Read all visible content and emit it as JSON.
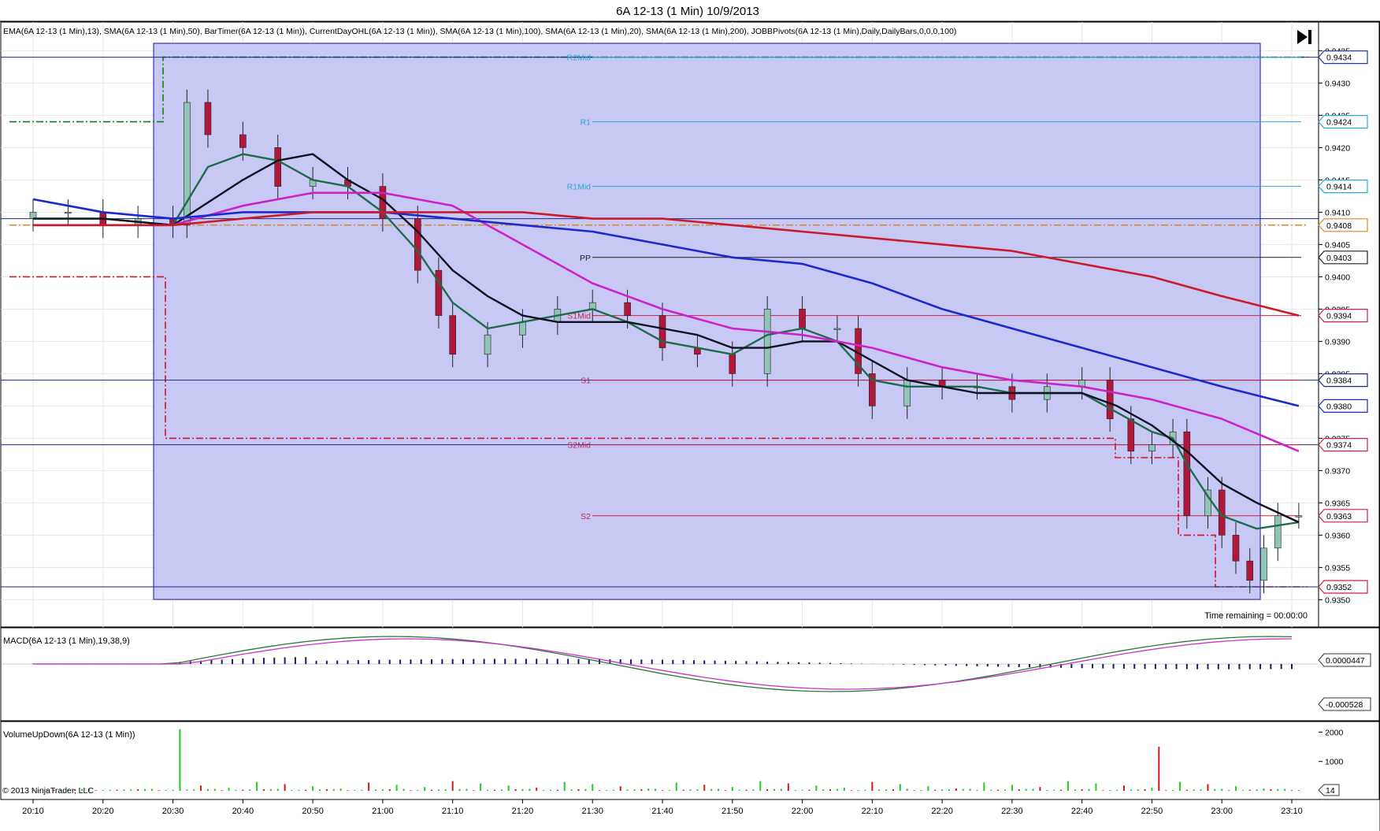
{
  "window": {
    "title": "6A 12-13 (1 Min)  10/9/2013"
  },
  "toolbar": {
    "jump_to_end_icon": "skip-to-end-icon"
  },
  "price_panel": {
    "indicator_list": "EMA(6A 12-13 (1 Min),13), SMA(6A 12-13 (1 Min),50), BarTimer(6A 12-13 (1 Min)), CurrentDayOHL(6A 12-13 (1 Min)), SMA(6A 12-13 (1 Min),100), SMA(6A 12-13 (1 Min),20), SMA(6A 12-13 (1 Min),200), JOBBPivots(6A 12-13 (1 Min),Daily,DailyBars,0,0,0,100)",
    "time_remaining": "Time remaining = 00:00:00",
    "y_ticks": [
      "0.9435",
      "0.9430",
      "0.9425",
      "0.9420",
      "0.9415",
      "0.9410",
      "0.9405",
      "0.9400",
      "0.9395",
      "0.9390",
      "0.9385",
      "0.9380",
      "0.9375",
      "0.9370",
      "0.9365",
      "0.9360",
      "0.9355",
      "0.9350"
    ],
    "price_markers": [
      {
        "label": "0.9434",
        "color": "#2a3a9a"
      },
      {
        "label": "0.9424",
        "color": "#2aa8d8"
      },
      {
        "label": "0.9414",
        "color": "#2aa8d8"
      },
      {
        "label": "0.9408",
        "color": "#d88a20"
      },
      {
        "label": "0.9403",
        "color": "#222222"
      },
      {
        "label": "0.9394",
        "color": "#cc2244"
      },
      {
        "label": "0.9384",
        "color": "#1a2a8a"
      },
      {
        "label": "0.9380",
        "color": "#1a2acc"
      },
      {
        "label": "0.9374",
        "color": "#cc2244"
      },
      {
        "label": "0.9363",
        "color": "#cc2244"
      },
      {
        "label": "0.9352",
        "color": "#cc2244"
      }
    ],
    "pivot_labels": [
      "R2Mid",
      "R1",
      "R1Mid",
      "PP",
      "S1Mid",
      "S1",
      "S2Mid",
      "S2"
    ]
  },
  "macd_panel": {
    "label": "MACD(6A 12-13 (1 Min),19,38,9)",
    "markers": [
      "0.0000447",
      "-0.000528"
    ]
  },
  "volume_panel": {
    "label": "VolumeUpDown(6A 12-13 (1 Min))",
    "y_ticks": [
      "2000",
      "1000"
    ],
    "marker": "14",
    "copyright": "© 2013 NinjaTrader, LLC"
  },
  "x_axis": {
    "ticks": [
      "20:10",
      "20:20",
      "20:30",
      "20:40",
      "20:50",
      "21:00",
      "21:10",
      "21:20",
      "21:30",
      "21:40",
      "21:50",
      "22:00",
      "22:10",
      "22:20",
      "22:30",
      "22:40",
      "22:50",
      "23:00",
      "23:10"
    ]
  },
  "chart_data": {
    "type": "line",
    "title": "6A 12-13 (1 Min)  10/9/2013",
    "xlabel": "",
    "ylabel": "",
    "ylim": [
      0.9347,
      0.9437
    ],
    "grid": true,
    "candles_approx": {
      "time": [
        "20:10",
        "20:15",
        "20:20",
        "20:25",
        "20:30",
        "20:32",
        "20:35",
        "20:40",
        "20:45",
        "20:50",
        "20:55",
        "21:00",
        "21:05",
        "21:08",
        "21:10",
        "21:15",
        "21:20",
        "21:25",
        "21:30",
        "21:35",
        "21:40",
        "21:45",
        "21:50",
        "21:55",
        "22:00",
        "22:05",
        "22:08",
        "22:10",
        "22:15",
        "22:20",
        "22:25",
        "22:30",
        "22:35",
        "22:40",
        "22:44",
        "22:47",
        "22:50",
        "22:53",
        "22:55",
        "22:58",
        "23:00",
        "23:02",
        "23:04",
        "23:06",
        "23:08",
        "23:11"
      ],
      "close": [
        0.941,
        0.941,
        0.9408,
        0.9409,
        0.9408,
        0.9427,
        0.9422,
        0.942,
        0.9414,
        0.9415,
        0.9414,
        0.9409,
        0.9401,
        0.9394,
        0.9388,
        0.9391,
        0.9393,
        0.9395,
        0.9396,
        0.9394,
        0.9389,
        0.9388,
        0.9385,
        0.9395,
        0.9392,
        0.9392,
        0.9385,
        0.938,
        0.9384,
        0.9383,
        0.9383,
        0.9381,
        0.9383,
        0.9384,
        0.9378,
        0.9373,
        0.9374,
        0.9376,
        0.9363,
        0.9367,
        0.936,
        0.9356,
        0.9353,
        0.9358,
        0.9363,
        0.9363
      ]
    },
    "series": [
      {
        "name": "EMA(6A 12-13 (1 Min),13)",
        "color": "#1f6b4a",
        "x": [
          "20:10",
          "20:20",
          "20:30",
          "20:35",
          "20:40",
          "20:45",
          "20:50",
          "20:55",
          "21:00",
          "21:05",
          "21:10",
          "21:15",
          "21:20",
          "21:25",
          "21:30",
          "21:35",
          "21:40",
          "21:45",
          "21:50",
          "21:55",
          "22:00",
          "22:05",
          "22:10",
          "22:15",
          "22:20",
          "22:25",
          "22:30",
          "22:35",
          "22:40",
          "22:45",
          "22:50",
          "22:53",
          "22:55",
          "22:58",
          "23:00",
          "23:05",
          "23:11"
        ],
        "y": [
          0.9409,
          0.9409,
          0.9408,
          0.9417,
          0.9419,
          0.9418,
          0.9415,
          0.9414,
          0.941,
          0.9404,
          0.9396,
          0.9392,
          0.9393,
          0.9394,
          0.9395,
          0.9393,
          0.939,
          0.9389,
          0.9388,
          0.9391,
          0.9392,
          0.939,
          0.9384,
          0.9383,
          0.9383,
          0.9383,
          0.9382,
          0.9382,
          0.9382,
          0.9379,
          0.9376,
          0.9375,
          0.9371,
          0.9366,
          0.9363,
          0.9361,
          0.9362
        ]
      },
      {
        "name": "SMA(6A 12-13 (1 Min),20)",
        "color": "#111122",
        "x": [
          "20:10",
          "20:20",
          "20:30",
          "20:40",
          "20:45",
          "20:50",
          "20:55",
          "21:00",
          "21:05",
          "21:10",
          "21:15",
          "21:20",
          "21:25",
          "21:30",
          "21:35",
          "21:40",
          "21:45",
          "21:50",
          "21:55",
          "22:00",
          "22:05",
          "22:10",
          "22:15",
          "22:20",
          "22:25",
          "22:30",
          "22:35",
          "22:40",
          "22:45",
          "22:50",
          "22:55",
          "23:00",
          "23:05",
          "23:11"
        ],
        "y": [
          0.9409,
          0.9409,
          0.9408,
          0.9415,
          0.9418,
          0.9419,
          0.9415,
          0.9412,
          0.9407,
          0.9401,
          0.9397,
          0.9394,
          0.9393,
          0.9393,
          0.9393,
          0.9392,
          0.9391,
          0.9389,
          0.9389,
          0.939,
          0.939,
          0.9387,
          0.9384,
          0.9383,
          0.9382,
          0.9382,
          0.9382,
          0.9382,
          0.938,
          0.9377,
          0.9373,
          0.9368,
          0.9365,
          0.9362
        ]
      },
      {
        "name": "SMA(6A 12-13 (1 Min),50)",
        "color": "#cc22cc",
        "x": [
          "20:10",
          "20:20",
          "20:30",
          "20:40",
          "20:50",
          "21:00",
          "21:10",
          "21:20",
          "21:30",
          "21:40",
          "21:50",
          "22:00",
          "22:10",
          "22:20",
          "22:30",
          "22:40",
          "22:50",
          "23:00",
          "23:11"
        ],
        "y": [
          0.9408,
          0.9408,
          0.9408,
          0.9411,
          0.9413,
          0.9413,
          0.9411,
          0.9405,
          0.9399,
          0.9395,
          0.9392,
          0.9391,
          0.9389,
          0.9386,
          0.9384,
          0.9383,
          0.9381,
          0.9378,
          0.9373
        ]
      },
      {
        "name": "SMA(6A 12-13 (1 Min),100)",
        "color": "#1a2acc",
        "x": [
          "20:10",
          "20:20",
          "20:30",
          "20:40",
          "20:50",
          "21:00",
          "21:10",
          "21:20",
          "21:30",
          "21:40",
          "21:50",
          "22:00",
          "22:10",
          "22:20",
          "22:30",
          "22:40",
          "22:50",
          "23:00",
          "23:11"
        ],
        "y": [
          0.9412,
          0.941,
          0.9409,
          0.941,
          0.941,
          0.941,
          0.9409,
          0.9408,
          0.9407,
          0.9405,
          0.9403,
          0.9402,
          0.9399,
          0.9395,
          0.9392,
          0.9389,
          0.9386,
          0.9383,
          0.938
        ]
      },
      {
        "name": "SMA(6A 12-13 (1 Min),200)",
        "color": "#cc1a2a",
        "x": [
          "20:10",
          "20:20",
          "20:30",
          "20:40",
          "20:50",
          "21:00",
          "21:10",
          "21:20",
          "21:30",
          "21:40",
          "21:50",
          "22:00",
          "22:10",
          "22:20",
          "22:30",
          "22:40",
          "22:50",
          "23:00",
          "23:11"
        ],
        "y": [
          0.9408,
          0.9408,
          0.9408,
          0.9409,
          0.941,
          0.941,
          0.941,
          0.941,
          0.9409,
          0.9409,
          0.9408,
          0.9407,
          0.9406,
          0.9405,
          0.9404,
          0.9402,
          0.94,
          0.9397,
          0.9394
        ]
      }
    ],
    "levels": [
      {
        "name": "R2Mid",
        "value": 0.9434,
        "color": "#2aa8d8"
      },
      {
        "name": "R1",
        "value": 0.9424,
        "color": "#2aa8d8"
      },
      {
        "name": "R1Mid",
        "value": 0.9414,
        "color": "#2aa8d8"
      },
      {
        "name": "PP",
        "value": 0.9403,
        "color": "#222222"
      },
      {
        "name": "S1Mid",
        "value": 0.9394,
        "color": "#cc2244"
      },
      {
        "name": "S1",
        "value": 0.9384,
        "color": "#cc2244"
      },
      {
        "name": "S2Mid",
        "value": 0.9374,
        "color": "#cc2244"
      },
      {
        "name": "S2",
        "value": 0.9363,
        "color": "#cc2244"
      }
    ],
    "macd": {
      "start": 4.47e-05,
      "end": -0.000528
    },
    "volume": {
      "time": [
        "20:31",
        "22:51"
      ],
      "value": [
        2100,
        1500
      ],
      "ylim": [
        0,
        2200
      ]
    }
  }
}
